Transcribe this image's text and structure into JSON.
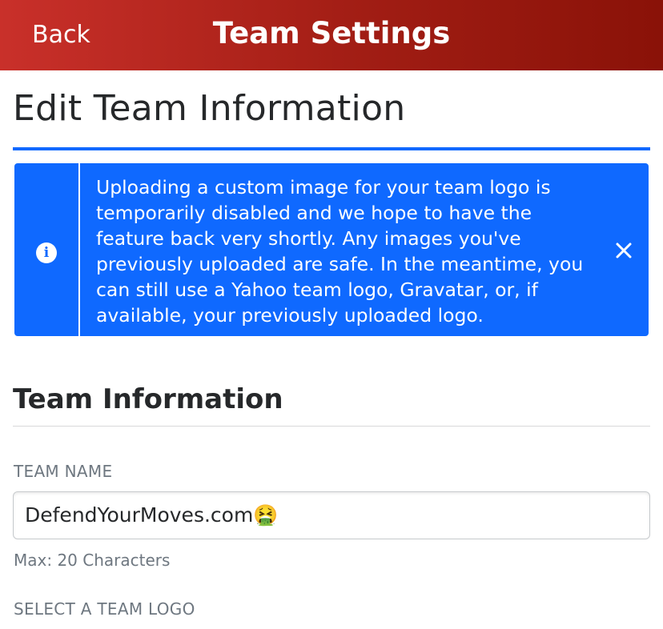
{
  "header": {
    "back_label": "Back",
    "title": "Team Settings"
  },
  "page": {
    "title": "Edit Team Information"
  },
  "notice": {
    "icon": "info-icon",
    "icon_glyph": "i",
    "text": "Uploading a custom image for your team logo is temporarily disabled and we hope to have the feature back very shortly. Any images you've previously uploaded are safe. In the meantime, you can still use a Yahoo team logo, Gravatar, or, if available, your previously uploaded logo.",
    "close_icon": "close-icon"
  },
  "team_information": {
    "heading": "Team Information",
    "team_name": {
      "label": "TEAM NAME",
      "value": "DefendYourMoves.com🤮",
      "helper": "Max: 20 Characters"
    },
    "team_logo": {
      "label": "SELECT A TEAM LOGO"
    }
  },
  "colors": {
    "header_gradient_start": "#c9302a",
    "header_gradient_end": "#8a1208",
    "accent_blue": "#0f69ff",
    "text_primary": "#26282a",
    "text_muted": "#6e7780"
  }
}
